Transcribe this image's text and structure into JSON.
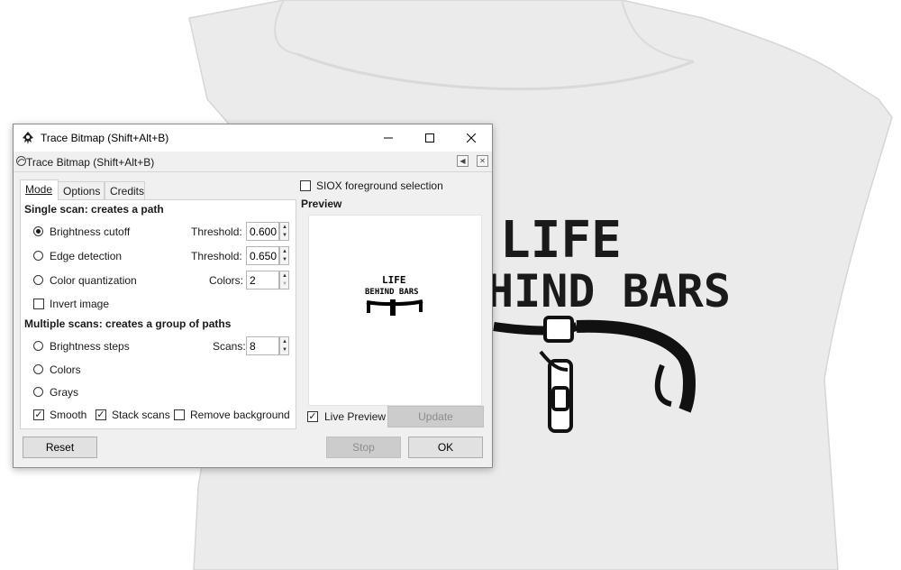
{
  "canvas": {
    "shirt_text_line1": "LIFE",
    "shirt_text_line2": "HIND BARS"
  },
  "window": {
    "title": "Trace Bitmap (Shift+Alt+B)",
    "minimize_label": "—",
    "maximize_label": "☐",
    "close_label": "✕"
  },
  "dock": {
    "title": "Trace Bitmap (Shift+Alt+B)"
  },
  "tabs": [
    {
      "label": "Mode",
      "active": true
    },
    {
      "label": "Options",
      "active": false
    },
    {
      "label": "Credits",
      "active": false
    }
  ],
  "single_scan": {
    "heading": "Single scan: creates a path",
    "brightness_label": "Brightness cutoff",
    "edge_label": "Edge detection",
    "color_quant_label": "Color quantization",
    "invert_label": "Invert image",
    "threshold_label": "Threshold:",
    "colors_label": "Colors:",
    "brightness_threshold": "0.600",
    "edge_threshold": "0.650",
    "colors_value": "2"
  },
  "multi_scan": {
    "heading": "Multiple scans: creates a group of paths",
    "brightness_steps_label": "Brightness steps",
    "colors_label": "Colors",
    "grays_label": "Grays",
    "scans_label": "Scans:",
    "scans_value": "8"
  },
  "bottom_options": {
    "smooth_label": "Smooth",
    "stack_label": "Stack scans",
    "remove_bg_label": "Remove background"
  },
  "siox_label": "SIOX foreground selection",
  "preview": {
    "heading": "Preview",
    "live_preview_label": "Live Preview",
    "update_label": "Update",
    "thumb_line1": "LIFE",
    "thumb_line2": "BEHIND BARS"
  },
  "buttons": {
    "reset": "Reset",
    "stop": "Stop",
    "ok": "OK"
  }
}
